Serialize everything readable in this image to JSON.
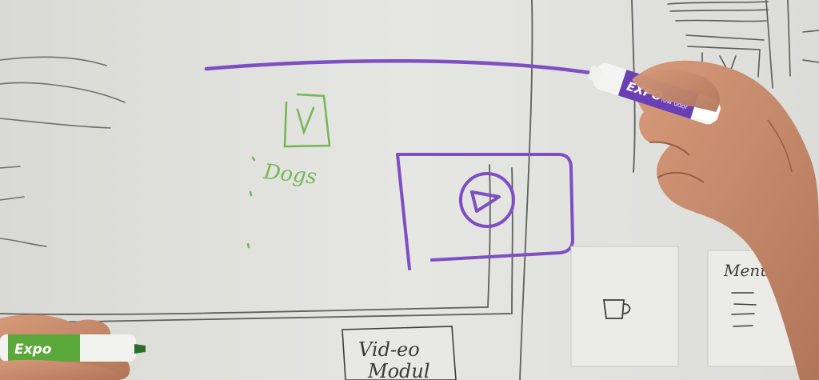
{
  "scene": {
    "description_hidden": "",
    "colors": {
      "whiteboard": "#e4e4e1",
      "whiteboard_shadow": "#d2d2cf",
      "gray_marker": "#5a5a58",
      "purple_marker": "#7d4fc2",
      "green_marker": "#7bbd5a",
      "sticky_note": "#ececea",
      "skin": "#c98d6f",
      "skin_shadow": "#a66a50"
    }
  },
  "board": {
    "green_note_words": "Dogs",
    "video_module_line1": "Vid-eo",
    "video_module_line2": "Modul",
    "menu_note": "Menu"
  },
  "markers": {
    "purple_brand": "EXPO",
    "purple_sub": "low odor",
    "green_brand": "Expo"
  }
}
